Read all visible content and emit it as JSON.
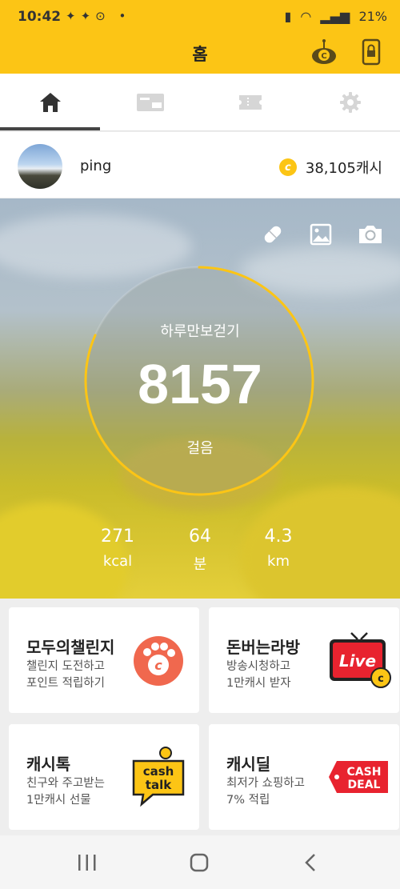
{
  "status_bar": {
    "time": "10:42",
    "battery": "21%"
  },
  "header": {
    "title": "홈"
  },
  "tabs": [
    {
      "name": "home",
      "active": true
    },
    {
      "name": "store",
      "active": false
    },
    {
      "name": "coupon",
      "active": false
    },
    {
      "name": "settings",
      "active": false
    }
  ],
  "profile": {
    "username": "ping",
    "cash": "38,105캐시"
  },
  "walk": {
    "title": "하루만보걷기",
    "steps": "8157",
    "steps_unit": "걸음",
    "progress": 0.8157,
    "stats": [
      {
        "value": "271",
        "unit": "kcal"
      },
      {
        "value": "64",
        "unit": "분"
      },
      {
        "value": "4.3",
        "unit": "km"
      }
    ]
  },
  "cards": [
    {
      "title": "모두의챌린지",
      "line1": "챌린지 도전하고",
      "line2": "포인트 적립하기",
      "icon": "paw-coin-icon"
    },
    {
      "title": "돈버는라방",
      "line1": "방송시청하고",
      "line2": "1만캐시 받자",
      "icon": "live-tv-icon",
      "icon_text": "Live"
    },
    {
      "title": "캐시톡",
      "line1": "친구와 주고받는",
      "line2": "1만캐시 선물",
      "icon": "cash-talk-icon",
      "icon_text1": "cash",
      "icon_text2": "talk"
    },
    {
      "title": "캐시딜",
      "line1": "최저가 쇼핑하고",
      "line2": "7% 적립",
      "icon": "cash-deal-tag-icon",
      "icon_text1": "CASH",
      "icon_text2": "DEAL"
    }
  ],
  "colors": {
    "brand": "#fcc515",
    "card_accent": "#f0684e",
    "live_red": "#e8232f"
  }
}
